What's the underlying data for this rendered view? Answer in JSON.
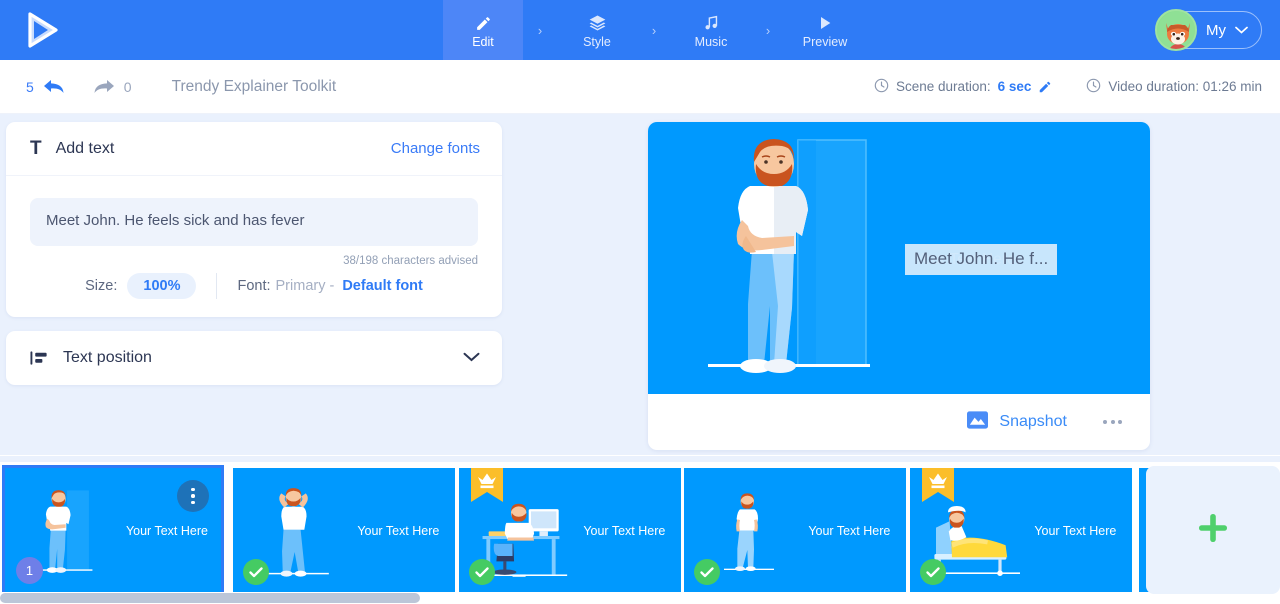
{
  "header": {
    "logo_icon": "play-triangle-logo",
    "steps": [
      {
        "label": "Edit",
        "icon": "pencil-icon",
        "active": true
      },
      {
        "label": "Style",
        "icon": "layers-icon",
        "active": false
      },
      {
        "label": "Music",
        "icon": "music-note-icon",
        "active": false
      },
      {
        "label": "Preview",
        "icon": "play-icon",
        "active": false
      }
    ],
    "separator": "›",
    "user": {
      "name": "My",
      "avatar_icon": "fox-avatar",
      "chevron": "chevron-down-icon"
    },
    "colors": {
      "bar": "#2f7bf6",
      "active_tab": "#4d86f7"
    }
  },
  "toolbar": {
    "undo_count": "5",
    "redo_count": "0",
    "undo_icon": "undo-arrow-icon",
    "redo_icon": "redo-arrow-icon",
    "project_title": "Trendy Explainer Toolkit",
    "scene_duration_label": "Scene duration:",
    "scene_duration_value": "6 sec",
    "scene_duration_edit_icon": "pencil-edit-icon",
    "video_duration_label": "Video duration: 01:26 min",
    "clock_icon": "clock-icon"
  },
  "add_text_panel": {
    "icon": "text-format-icon",
    "title": "Add text",
    "change_fonts_link": "Change fonts",
    "input_value": "Meet John. He feels sick and has fever",
    "input_placeholder": "Your Text Here",
    "char_count": "38/198 characters advised",
    "size_label": "Size:",
    "size_value": "100%",
    "font_label": "Font:",
    "font_primary": "Primary -",
    "font_default": "Default font"
  },
  "text_position_panel": {
    "icon": "align-left-icon",
    "title": "Text position",
    "chevron": "chevron-down-icon"
  },
  "preview": {
    "canvas_text": "Meet John. He f...",
    "ghost_text": "Your Text Here",
    "canvas_color": "#0099fe",
    "illustration": "man-leaning-on-wall",
    "snapshot_label": "Snapshot",
    "snapshot_icon": "image-photo-icon",
    "more_icon": "more-horizontal-icon"
  },
  "filmstrip": {
    "thumbnails": [
      {
        "text": "Your Text Here",
        "selected": true,
        "badge": "number",
        "badge_value": "1",
        "premium": false,
        "menu_icon": "more-vertical-icon",
        "illustration": "man-leaning-on-wall"
      },
      {
        "text": "Your Text Here",
        "selected": false,
        "badge": "check",
        "badge_value": "✓",
        "premium": false,
        "illustration": "man-holding-head"
      },
      {
        "text": "Your Text Here",
        "selected": false,
        "badge": "check",
        "badge_value": "✓",
        "premium": true,
        "illustration": "man-at-desk"
      },
      {
        "text": "Your Text Here",
        "selected": false,
        "badge": "check",
        "badge_value": "✓",
        "premium": false,
        "illustration": "man-standing-tired"
      },
      {
        "text": "Your Text Here",
        "selected": false,
        "badge": "check",
        "badge_value": "✓",
        "premium": true,
        "illustration": "man-in-hospital-bed"
      },
      {
        "text": "",
        "selected": false,
        "badge": "check",
        "badge_value": "✓",
        "premium": false,
        "illustration": "partial-scene"
      }
    ],
    "add_scene_icon": "plus-icon",
    "add_scene_color": "#4fd06c",
    "crown_icon": "crown-ribbon-icon",
    "check_icon": "check-icon"
  }
}
